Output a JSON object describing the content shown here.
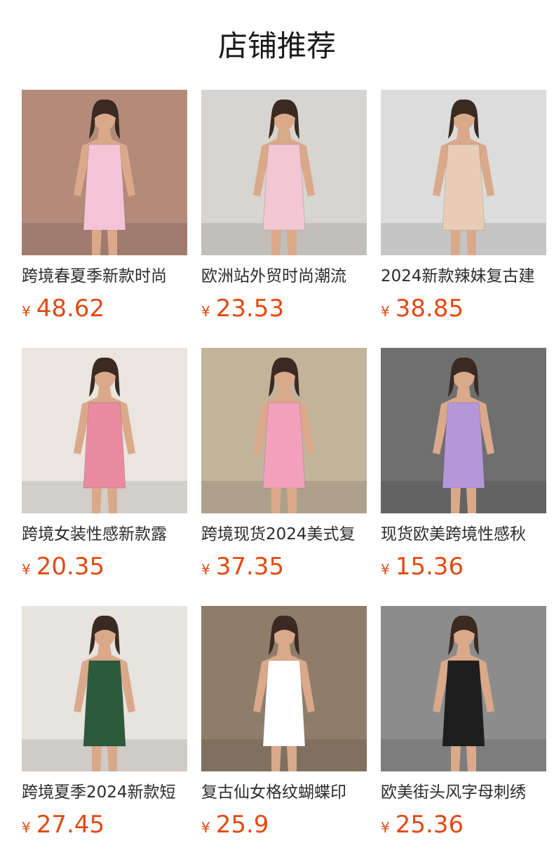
{
  "header": {
    "title": "店铺推荐"
  },
  "colors": {
    "price": "#e24a12",
    "text": "#2b2b2b"
  },
  "products": [
    {
      "name": "跨境春夏季新款时尚",
      "currency": "¥",
      "price": "48.62",
      "image": "pink-bodycon-dress-photo",
      "bg": "#b48a7a",
      "accent": "#f3c4d6"
    },
    {
      "name": "欧洲站外贸时尚潮流",
      "currency": "¥",
      "price": "23.53",
      "image": "pink-ruffle-tube-dress-photo",
      "bg": "#d7d5cf",
      "accent": "#f2c6d2"
    },
    {
      "name": "2024新款辣妹复古建",
      "currency": "¥",
      "price": "38.85",
      "image": "brown-graphic-crop-top-photo",
      "bg": "#dcdcdc",
      "accent": "#e8cdb6"
    },
    {
      "name": "跨境女装性感新款露",
      "currency": "¥",
      "price": "20.35",
      "image": "tie-dye-crop-top-photo",
      "bg": "#eae6df",
      "accent": "#e98aa1"
    },
    {
      "name": "跨境现货2024美式复",
      "currency": "¥",
      "price": "37.35",
      "image": "pink-checker-knit-cami-photo",
      "bg": "#c2b49b",
      "accent": "#f2a1bd"
    },
    {
      "name": "现货欧美跨境性感秋",
      "currency": "¥",
      "price": "15.36",
      "image": "purple-satin-corset-top-photo",
      "bg": "#6f6f6f",
      "accent": "#b497d8"
    },
    {
      "name": "跨境夏季2024新款短",
      "currency": "¥",
      "price": "27.45",
      "image": "green-velvet-slip-dress-photo",
      "bg": "#e7e3de",
      "accent": "#2c5a3c"
    },
    {
      "name": "复古仙女格纹蝴蝶印",
      "currency": "¥",
      "price": "25.9",
      "image": "butterfly-print-crop-tee-photo",
      "bg": "#8f7d6a",
      "accent": "#ffffff"
    },
    {
      "name": "欧美街头风字母刺绣",
      "currency": "¥",
      "price": "25.36",
      "image": "black-tube-top-skirt-set-photo",
      "bg": "#8c8c8c",
      "accent": "#1e1e1e"
    }
  ]
}
